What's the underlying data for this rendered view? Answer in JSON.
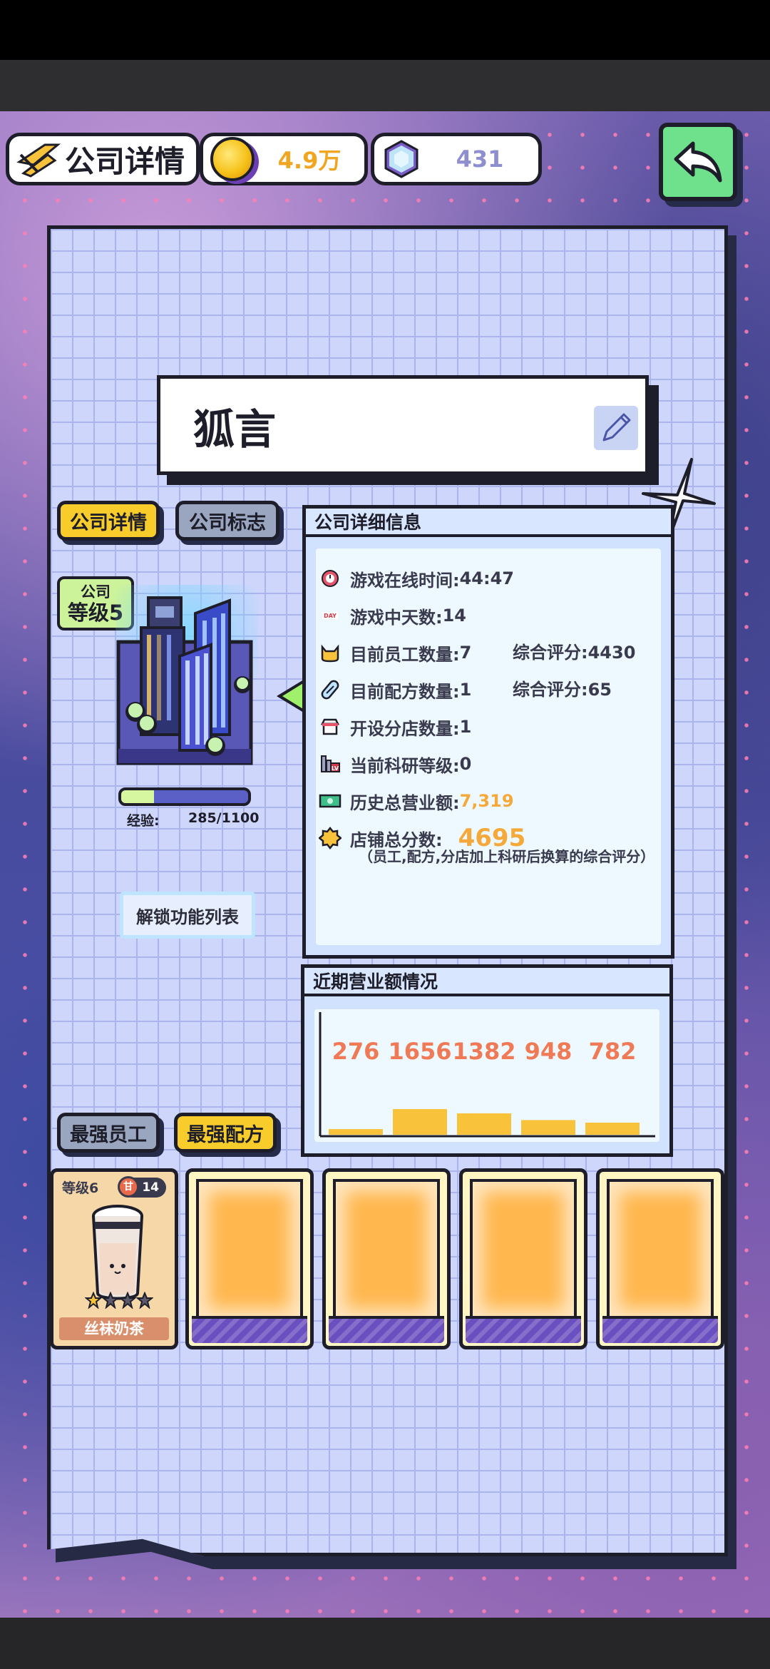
{
  "header": {
    "title": "公司详情",
    "coins": "4.9万",
    "gems": "431"
  },
  "company": {
    "name": "狐言",
    "level_caption": "公司",
    "level": "等级5",
    "xp_label": "经验:",
    "xp_value": "285/1100",
    "xp_progress": 0.26,
    "unlock_button": "解锁功能列表"
  },
  "tabs": {
    "details": "公司详情",
    "logo": "公司标志",
    "best_staff": "最强员工",
    "best_recipe": "最强配方"
  },
  "info_panel": {
    "title": "公司详细信息",
    "rows": [
      {
        "icon": "clock-icon",
        "label": "游戏在线时间:",
        "value": "44:47"
      },
      {
        "icon": "day-icon",
        "label": "游戏中天数:",
        "value": "14"
      },
      {
        "icon": "cat-icon",
        "label": "目前员工数量:",
        "value": "7",
        "extra_label": "综合评分:",
        "extra_value": "4430"
      },
      {
        "icon": "capsule-icon",
        "label": "目前配方数量:",
        "value": "1",
        "extra_label": "综合评分:",
        "extra_value": "65"
      },
      {
        "icon": "shop-icon",
        "label": "开设分店数量:",
        "value": "1"
      },
      {
        "icon": "research-icon",
        "label": "当前科研等级:",
        "value": "0"
      },
      {
        "icon": "cash-icon",
        "label": "历史总营业额:",
        "value": "7,319"
      },
      {
        "icon": "star-badge-icon",
        "label": "店铺总分数:",
        "value": "4695"
      }
    ],
    "note": "（员工,配方,分店加上科研后换算的综合评分）"
  },
  "revenue_panel": {
    "title": "近期营业额情况"
  },
  "chart_data": {
    "type": "bar",
    "categories": [
      "",
      "",
      "",
      "",
      ""
    ],
    "values": [
      276,
      1656,
      1382,
      948,
      782
    ],
    "title": "近期营业额情况",
    "xlabel": "",
    "ylabel": "",
    "data_labels": [
      "276",
      "1656",
      "1382",
      "948",
      "782"
    ],
    "bar_color": "#f8c23a",
    "label_color": "#ef7a55",
    "grid": false
  },
  "cards": [
    {
      "level": "等级6",
      "badge": "14",
      "name": "丝袜奶茶",
      "stars": 1,
      "max_stars": 4
    },
    {
      "empty": true
    },
    {
      "empty": true
    },
    {
      "empty": true
    },
    {
      "empty": true
    }
  ],
  "colors": {
    "accent_yellow": "#f8cd2b",
    "back_green": "#6fe18c",
    "paper": "#cfd6fb",
    "orange_text": "#f5a93a"
  }
}
